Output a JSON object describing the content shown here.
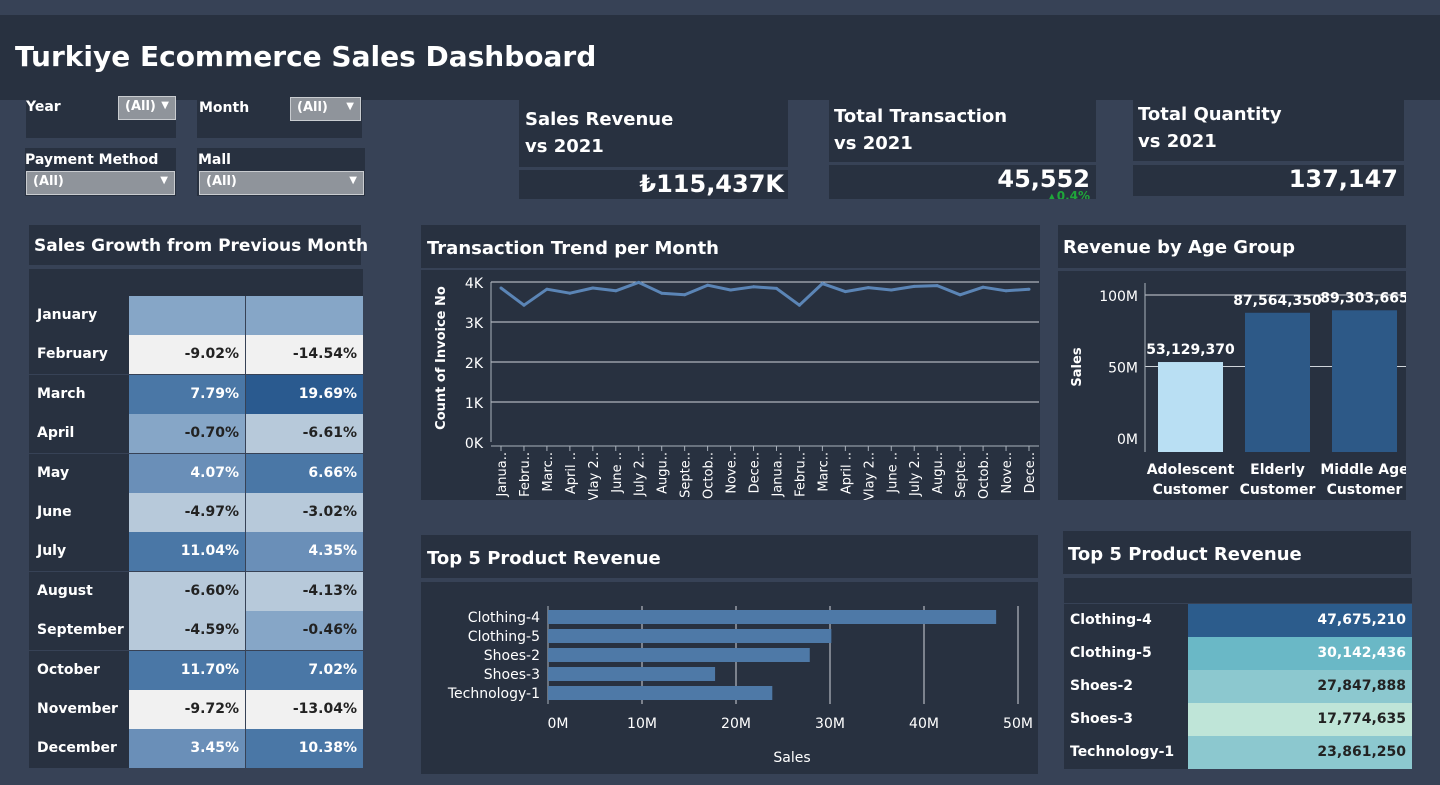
{
  "title": "Turkiye Ecommerce Sales Dashboard",
  "filters": {
    "year": {
      "label": "Year",
      "value": "(All)"
    },
    "month": {
      "label": "Month",
      "value": "(All)"
    },
    "payment_method": {
      "label": "Payment Method",
      "value": "(All)"
    },
    "mall": {
      "label": "Mall",
      "value": "(All)"
    }
  },
  "kpis": {
    "sales_revenue": {
      "line1": "Sales Revenue",
      "line2": "vs 2021",
      "value": "₺115,437K"
    },
    "total_transaction": {
      "line1": "Total Transaction",
      "line2": "vs 2021",
      "value": "45,552",
      "delta": "0.4%"
    },
    "total_quantity": {
      "line1": "Total Quantity",
      "line2": "vs 2021",
      "value": "137,147"
    }
  },
  "sales_growth": {
    "title": "Sales Growth from Previous Month",
    "rows": [
      {
        "month": "January",
        "v1": "",
        "v2": ""
      },
      {
        "month": "February",
        "v1": "-9.02%",
        "v2": "-14.54%"
      },
      {
        "month": "March",
        "v1": "7.79%",
        "v2": "19.69%"
      },
      {
        "month": "April",
        "v1": "-0.70%",
        "v2": "-6.61%"
      },
      {
        "month": "May",
        "v1": "4.07%",
        "v2": "6.66%"
      },
      {
        "month": "June",
        "v1": "-4.97%",
        "v2": "-3.02%"
      },
      {
        "month": "July",
        "v1": "11.04%",
        "v2": "4.35%"
      },
      {
        "month": "August",
        "v1": "-6.60%",
        "v2": "-4.13%"
      },
      {
        "month": "September",
        "v1": "-4.59%",
        "v2": "-0.46%"
      },
      {
        "month": "October",
        "v1": "11.70%",
        "v2": "7.02%"
      },
      {
        "month": "November",
        "v1": "-9.72%",
        "v2": "-13.04%"
      },
      {
        "month": "December",
        "v1": "3.45%",
        "v2": "10.38%"
      }
    ]
  },
  "colors": {
    "background": "#374256",
    "panel": "#283140",
    "line": "#5b85b6",
    "bar": "#4e79a7",
    "growth_scale": [
      "#f1f1f1",
      "#b7c9da",
      "#86a6c7",
      "#6a8fb8",
      "#4a77a6",
      "#2a5a8f"
    ],
    "top5_scale": [
      "#bfe5d8",
      "#8cc8cf",
      "#6ab8c6",
      "#55abc2",
      "#2c5c8c"
    ],
    "delta_up": "#1fa63a",
    "age_light": "#b9dff3",
    "age_dark": "#2d5987"
  },
  "chart_data": [
    {
      "type": "line",
      "title": "Transaction Trend per Month",
      "ylabel": "Count of Invoice No",
      "ylim": [
        0,
        4000
      ],
      "ytick_labels": [
        "0K",
        "1K",
        "2K",
        "3K",
        "4K"
      ],
      "grid": true,
      "x": [
        "Janua..",
        "Febru..",
        "Marc..",
        "April ..",
        "Vlay 2..",
        "June ..",
        "July 2..",
        "Augu..",
        "Septe..",
        "Octob..",
        "Nove..",
        "Dece..",
        "Janua..",
        "Febru..",
        "Marc..",
        "April ..",
        "Vlay 2..",
        "June ..",
        "July 2..",
        "Augu..",
        "Septe..",
        "Octob..",
        "Nove..",
        "Dece.."
      ],
      "series": [
        {
          "values": [
            3850,
            3420,
            3820,
            3720,
            3850,
            3780,
            3990,
            3720,
            3680,
            3920,
            3800,
            3880,
            3840,
            3420,
            3960,
            3760,
            3860,
            3800,
            3890,
            3910,
            3680,
            3870,
            3780,
            3820
          ]
        }
      ]
    },
    {
      "type": "bar",
      "title": "Revenue by Age Group",
      "ylabel": "Sales",
      "ylim": [
        0,
        100000000
      ],
      "ytick_labels": [
        "0M",
        "50M",
        "100M"
      ],
      "categories": [
        "Adolescent Customer",
        "Elderly Customer",
        "Middle Age Customer"
      ],
      "values": [
        53129370,
        87564350,
        89303665
      ],
      "data_labels": [
        "53,129,370",
        "87,564,350",
        "89,303,665"
      ]
    },
    {
      "type": "bar",
      "orientation": "horizontal",
      "title": "Top 5 Product Revenue",
      "xlabel": "Sales",
      "xlim": [
        0,
        50000000
      ],
      "xtick_labels": [
        "0M",
        "10M",
        "20M",
        "30M",
        "40M",
        "50M"
      ],
      "categories": [
        "Clothing-4",
        "Clothing-5",
        "Shoes-2",
        "Shoes-3",
        "Technology-1"
      ],
      "values": [
        47675210,
        30142436,
        27847888,
        17774635,
        23861250
      ]
    },
    {
      "type": "table",
      "title": "Top 5 Product Revenue",
      "rows": [
        {
          "name": "Clothing-4",
          "value": "47,675,210"
        },
        {
          "name": "Clothing-5",
          "value": "30,142,436"
        },
        {
          "name": "Shoes-2",
          "value": "27,847,888"
        },
        {
          "name": "Shoes-3",
          "value": "17,774,635"
        },
        {
          "name": "Technology-1",
          "value": "23,861,250"
        }
      ]
    }
  ]
}
